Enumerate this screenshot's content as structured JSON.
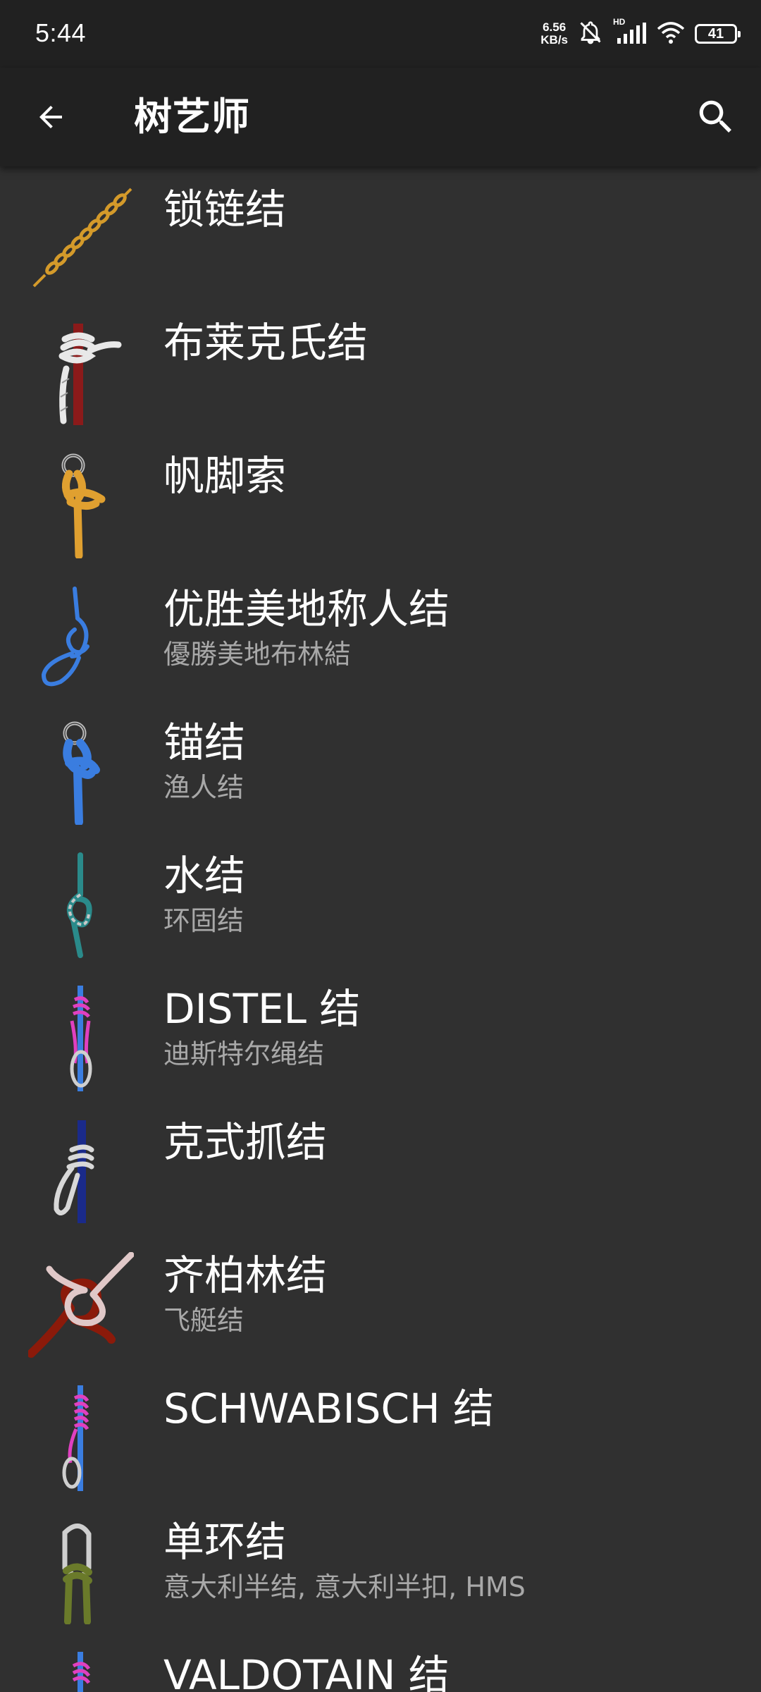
{
  "status_bar": {
    "time": "5:44",
    "net_speed_value": "6.56",
    "net_speed_unit": "KB/s",
    "hd_label": "HD",
    "battery_level": "41"
  },
  "app_bar": {
    "title": "树艺师",
    "back_icon": "arrow-back-icon",
    "search_icon": "search-icon"
  },
  "knots": [
    {
      "title": "锁链结",
      "subtitle": "",
      "thumb": "chain-knot-icon"
    },
    {
      "title": "布莱克氏结",
      "subtitle": "",
      "thumb": "blakes-hitch-icon"
    },
    {
      "title": "帆脚索",
      "subtitle": "",
      "thumb": "bowline-icon"
    },
    {
      "title": "优胜美地称人结",
      "subtitle": "優勝美地布林結",
      "thumb": "yosemite-bowline-icon"
    },
    {
      "title": "锚结",
      "subtitle": "渔人结",
      "thumb": "anchor-hitch-icon"
    },
    {
      "title": "水结",
      "subtitle": "环固结",
      "thumb": "water-knot-icon"
    },
    {
      "title": "DISTEL 结",
      "subtitle": "迪斯特尔绳结",
      "thumb": "distel-hitch-icon"
    },
    {
      "title": "克式抓结",
      "subtitle": "",
      "thumb": "klemheist-knot-icon"
    },
    {
      "title": "齐柏林结",
      "subtitle": "飞艇结",
      "thumb": "zeppelin-bend-icon"
    },
    {
      "title": "SCHWABISCH 结",
      "subtitle": "",
      "thumb": "schwabisch-hitch-icon"
    },
    {
      "title": "单环结",
      "subtitle": "意大利半结, 意大利半扣, HMS",
      "thumb": "munter-hitch-icon"
    },
    {
      "title": "VALDOTAIN 结",
      "subtitle": "",
      "thumb": "valdotain-tresse-icon"
    }
  ],
  "colors": {
    "background": "#303030",
    "app_bar": "#212121",
    "title_text": "#ffffff",
    "subtitle_text": "#a8a8a8"
  }
}
